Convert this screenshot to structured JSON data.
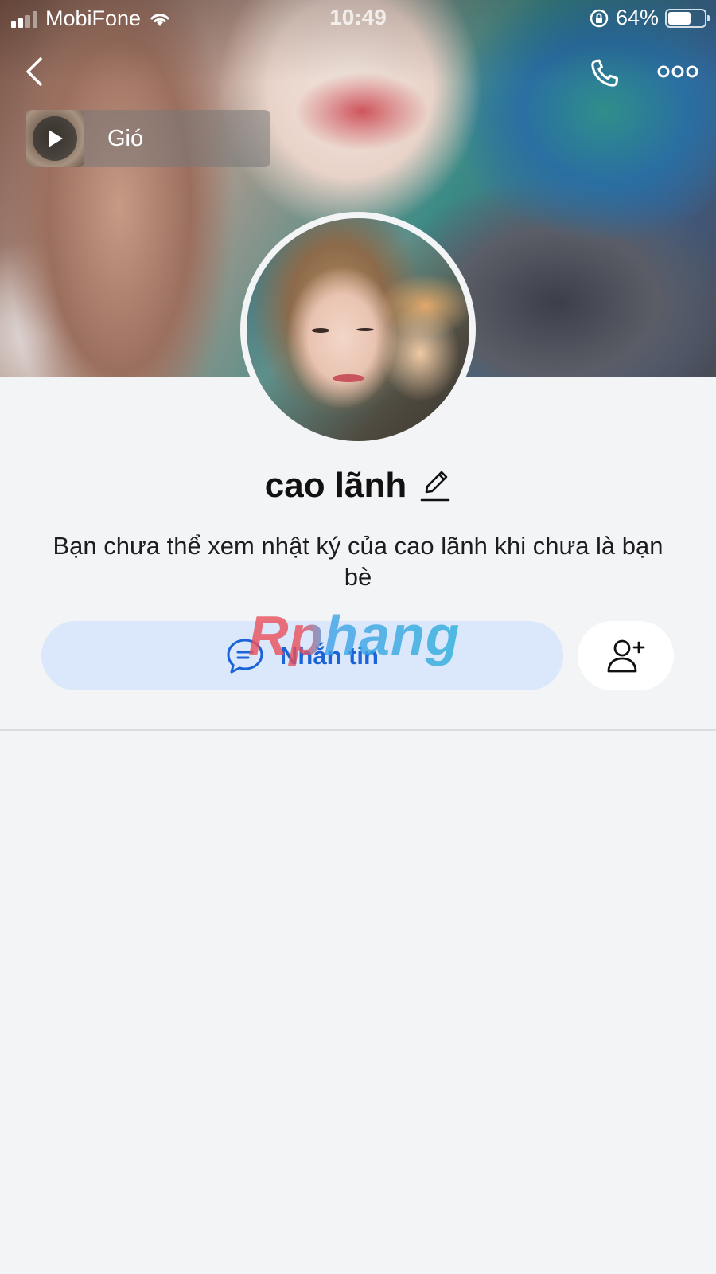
{
  "status_bar": {
    "carrier": "MobiFone",
    "time": "10:49",
    "battery_percent": "64%",
    "battery_level": 0.64,
    "signal_bars_active": 2
  },
  "nav": {
    "back_icon": "chevron-left-icon",
    "call_icon": "phone-icon",
    "more_icon": "more-dots-icon"
  },
  "music": {
    "title": "Gió",
    "play_icon": "play-icon"
  },
  "profile": {
    "name": "cao lãnh",
    "edit_icon": "pencil-icon",
    "friend_note": "Bạn chưa thể xem nhật ký của cao lãnh khi chưa là bạn bè"
  },
  "actions": {
    "message_label": "Nhắn tin",
    "message_icon": "chat-bubble-icon",
    "add_friend_icon": "add-user-icon"
  },
  "watermark": "Rphang",
  "colors": {
    "accent": "#1a63d8",
    "message_button_bg": "#dbe7fb",
    "page_bg": "#f3f4f6"
  }
}
